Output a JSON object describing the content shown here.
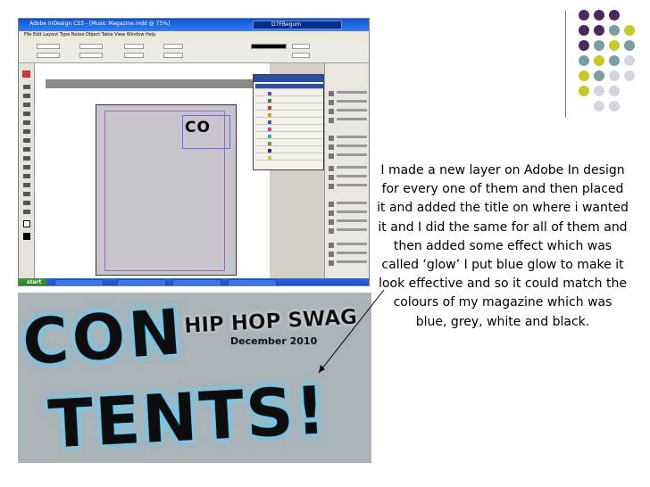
{
  "screenshot": {
    "window_title": "Adobe InDesign CS3 - [Music Magazine.indd @ 75%]",
    "user_badge": "D7FBegum",
    "menu": "File  Edit  Layout  Type  Notes  Object  Table  View  Window  Help",
    "frame_text": "CO",
    "start_label": "start"
  },
  "title_image": {
    "word_line1": "CON",
    "word_line2": "TENTS!",
    "tagline": "HIP HOP SWAG",
    "date": "December 2010"
  },
  "caption": "I made a new layer on Adobe In design for every one of them and then placed it and added the title on where i wanted it and I did the same for all of them and then added some effect which was called ‘glow’ I put blue glow to make it look effective and so it could match the colours of my magazine which was blue, grey, white and black.",
  "colors": {
    "dot_purple": "#4a2a5e",
    "dot_teal": "#7a9fa0",
    "dot_olive": "#c9c72a",
    "dot_lavender": "#d6d2e0",
    "glow_blue": "#5fd0ff"
  }
}
